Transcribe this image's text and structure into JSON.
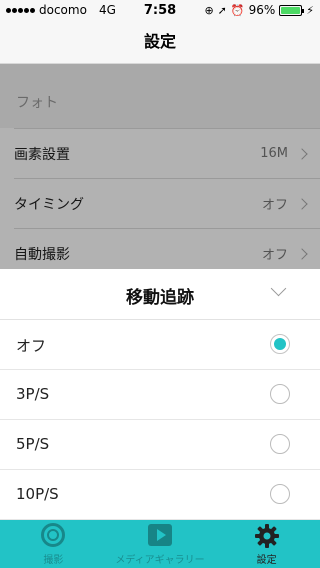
{
  "status_bar": {
    "carrier": "docomo",
    "network": "4G",
    "time": "7:58",
    "battery_percent": "96%",
    "battery_level": 0.96,
    "icons": [
      "signal-icon",
      "lock-rotation-icon",
      "location-icon",
      "alarm-icon",
      "battery-icon",
      "charging-icon"
    ]
  },
  "nav": {
    "title": "設定"
  },
  "settings": {
    "section_title": "フォト",
    "rows": [
      {
        "label": "画素設置",
        "value": "16M"
      },
      {
        "label": "タイミング",
        "value": "オフ"
      },
      {
        "label": "自動撮影",
        "value": "オフ"
      }
    ]
  },
  "sheet": {
    "title": "移動追跡",
    "options": [
      {
        "label": "オフ",
        "selected": true
      },
      {
        "label": "3P/S",
        "selected": false
      },
      {
        "label": "5P/S",
        "selected": false
      },
      {
        "label": "10P/S",
        "selected": false
      }
    ]
  },
  "tabs": [
    {
      "label": "撮影",
      "icon": "camera-lens-icon",
      "active": false
    },
    {
      "label": "メディアギャラリー",
      "icon": "play-icon",
      "active": false
    },
    {
      "label": "設定",
      "icon": "gear-icon",
      "active": true
    }
  ],
  "colors": {
    "accent": "#22c3c6",
    "battery": "#4cd964"
  }
}
